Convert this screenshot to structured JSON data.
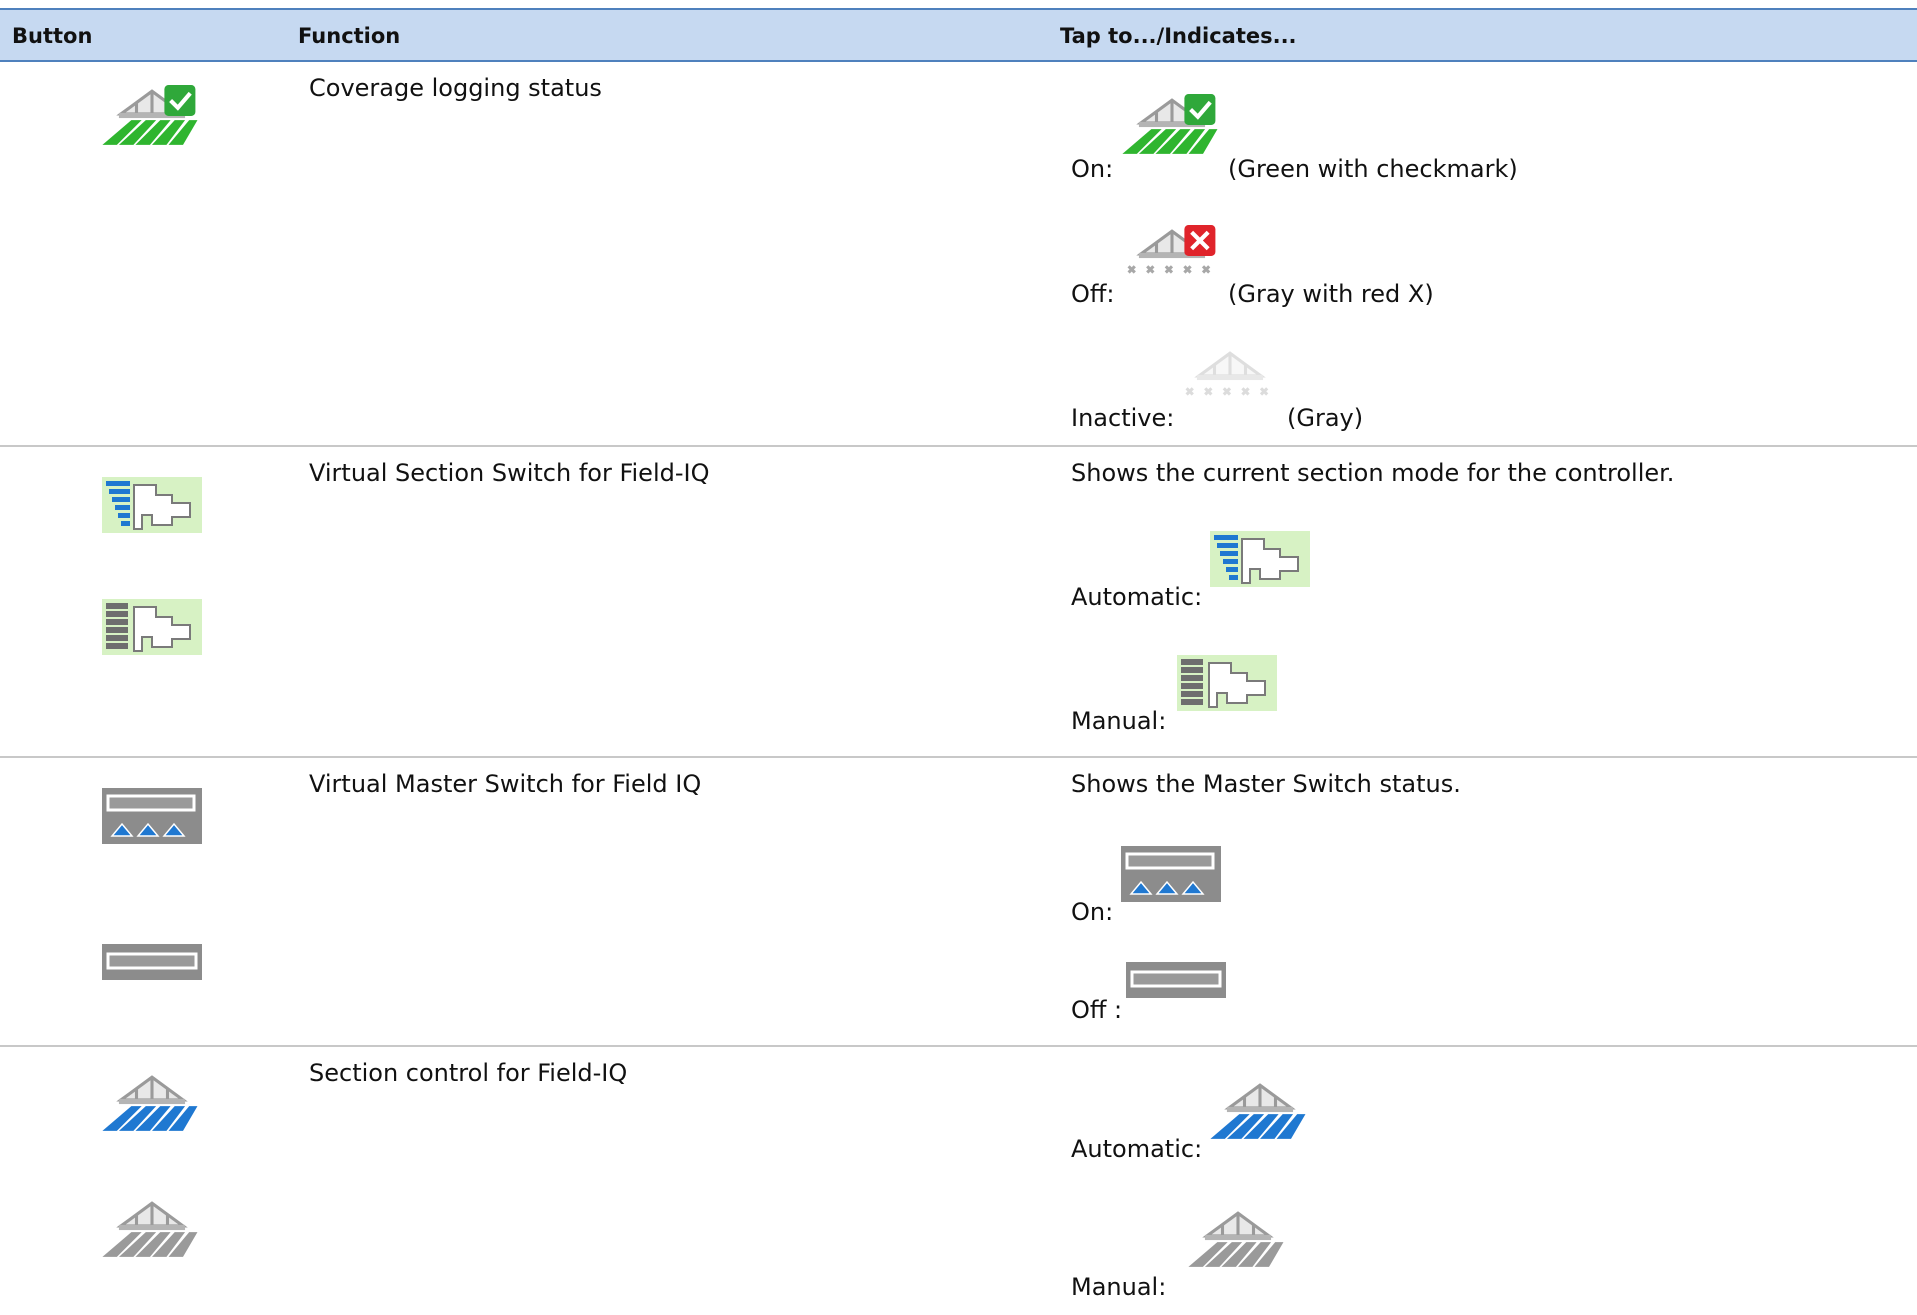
{
  "header": {
    "col_button": "Button",
    "col_function": "Function",
    "col_indicates": "Tap to.../Indicates..."
  },
  "rows": [
    {
      "function": "Coverage logging status",
      "states": [
        {
          "label": "On:",
          "note": "(Green with checkmark)",
          "icon": "coverage-logging-on-icon"
        },
        {
          "label": "Off:",
          "note": "(Gray with red X)",
          "icon": "coverage-logging-off-icon"
        },
        {
          "label": "Inactive:",
          "note": "(Gray)",
          "icon": "coverage-logging-inactive-icon"
        }
      ]
    },
    {
      "function": "Virtual Section Switch for Field-IQ",
      "intro": "Shows the current section mode for the controller.",
      "states": [
        {
          "label": "Automatic:",
          "icon": "section-switch-automatic-icon"
        },
        {
          "label": "Manual:",
          "icon": "section-switch-manual-icon"
        }
      ]
    },
    {
      "function": "Virtual Master Switch for Field IQ",
      "intro": "Shows the Master Switch status.",
      "states": [
        {
          "label": "On:",
          "icon": "master-switch-on-icon"
        },
        {
          "label": "Off :",
          "icon": "master-switch-off-icon"
        }
      ]
    },
    {
      "function": "Section control for Field-IQ",
      "states": [
        {
          "label": "Automatic:",
          "icon": "section-control-automatic-icon"
        },
        {
          "label": "Manual:",
          "icon": "section-control-manual-icon"
        }
      ]
    }
  ],
  "colors": {
    "header_bg": "#c6d9f1",
    "header_rule": "#4f81bd",
    "row_rule": "#c8c8c8",
    "green": "#2fb52f",
    "blue": "#1f78d1",
    "red": "#e0242b",
    "icon_bg_green": "#d7f2c4",
    "icon_bg_gray": "#8c8c8c"
  }
}
